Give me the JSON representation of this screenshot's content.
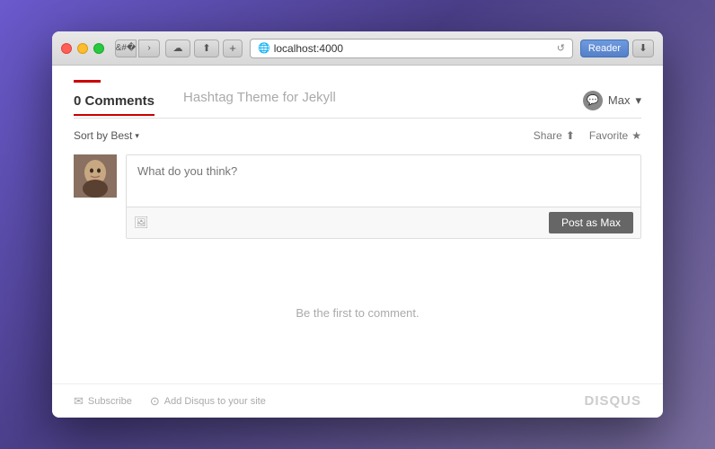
{
  "window": {
    "url": "localhost:4000",
    "reader_btn": "Reader",
    "resize_icon": "⤢"
  },
  "tabs": {
    "comments_label": "0 Comments",
    "hashtag_label": "Hashtag Theme for Jekyll"
  },
  "user": {
    "name": "Max",
    "dropdown": "▾"
  },
  "sort": {
    "label": "Sort by Best",
    "chevron": "▾",
    "share_label": "Share",
    "favorite_label": "Favorite",
    "share_icon": "⬆",
    "favorite_icon": "★"
  },
  "comment_input": {
    "placeholder": "What do you think?",
    "post_btn_label": "Post as Max"
  },
  "empty_state": {
    "text": "Be the first to comment."
  },
  "footer": {
    "subscribe_label": "Subscribe",
    "add_disqus_label": "Add Disqus to your site",
    "disqus_logo": "DISQUS"
  }
}
